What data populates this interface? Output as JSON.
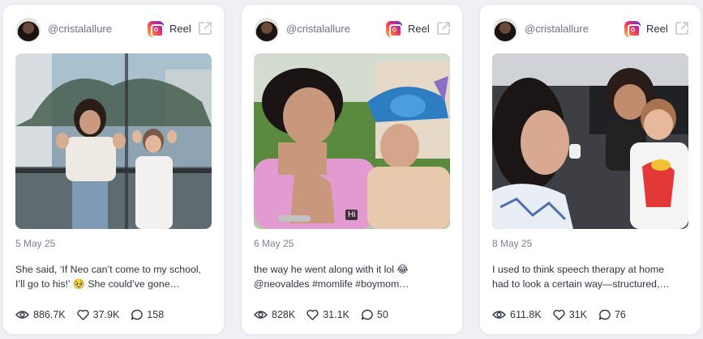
{
  "posts": [
    {
      "handle": "@cristalallure",
      "platform_label": "Reel",
      "platform_icon": "instagram-icon",
      "date": "5 May 25",
      "caption_line1": "She said, ‘If Neo can’t come to my school,",
      "caption_line2": "I’ll go to his!’ 🥹 She could’ve gone…",
      "views": "886.7K",
      "likes": "37.9K",
      "comments": "158"
    },
    {
      "handle": "@cristalallure",
      "platform_label": "Reel",
      "platform_icon": "instagram-icon",
      "date": "6 May 25",
      "caption_line1": "the way he went along with it lol 😂",
      "caption_line2": "@neovaldes #momlife #boymom…",
      "views": "828K",
      "likes": "31.1K",
      "comments": "50",
      "overlay_text": "Hi"
    },
    {
      "handle": "@cristalallure",
      "platform_label": "Reel",
      "platform_icon": "instagram-icon",
      "date": "8 May 25",
      "caption_line1": "I used to think speech therapy at home",
      "caption_line2": "had to look a certain way—structured,…",
      "views": "611.8K",
      "likes": "31K",
      "comments": "76"
    }
  ],
  "colors": {
    "background": "#eef0f5",
    "card": "#ffffff",
    "text_primary": "#2d3340",
    "text_muted": "#7a8194"
  }
}
